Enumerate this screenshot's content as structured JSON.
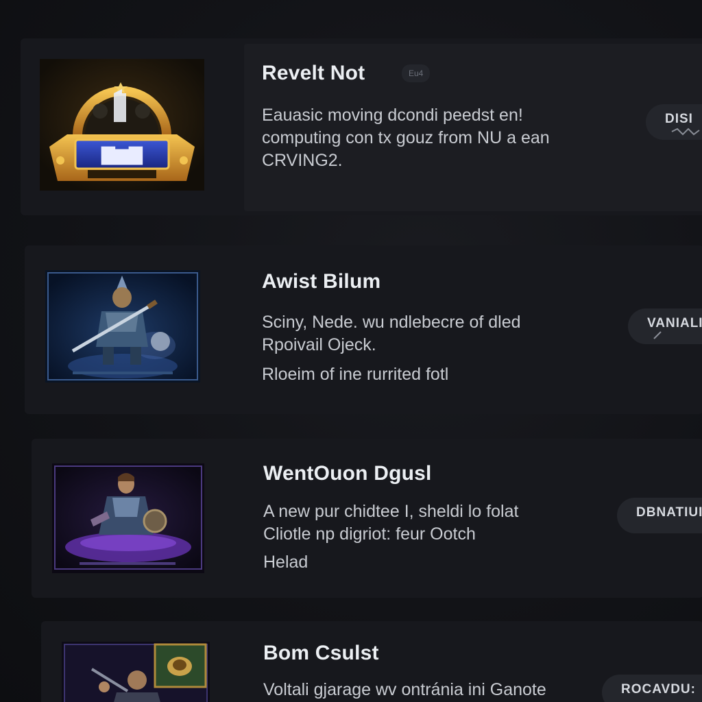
{
  "items": [
    {
      "title": "Revelt Not",
      "badge": "Eu4",
      "desc_lines": [
        "Eauasic moving dcondi peedst en!",
        "computing con tx gouz from NU a ean",
        "CRVING2."
      ],
      "action_label": "DISI",
      "thumb_icon": "emblem-icon"
    },
    {
      "title": "Awist Bilum",
      "desc_lines": [
        "Sciny, Nede. wu ndlebecre of dled",
        "Rpoivail Ojeck.",
        "Rloeim of ine rurrited fotl"
      ],
      "action_label": "VANIALI",
      "thumb_icon": "warrior-icon"
    },
    {
      "title": "WentOuon Dgusl",
      "desc_lines": [
        "A new pur chidtee I, sheldi lo folat",
        "Cliotle np digriot: feur Ootch",
        "Helad"
      ],
      "action_label": "DBNATIUI",
      "thumb_icon": "knight-icon"
    },
    {
      "title": "Bom Csulst",
      "desc_lines": [
        "Voltali gjarage wv ontránia ini Ganote"
      ],
      "action_label": "ROCAVDU:",
      "thumb_icon": "hero-icon"
    }
  ]
}
